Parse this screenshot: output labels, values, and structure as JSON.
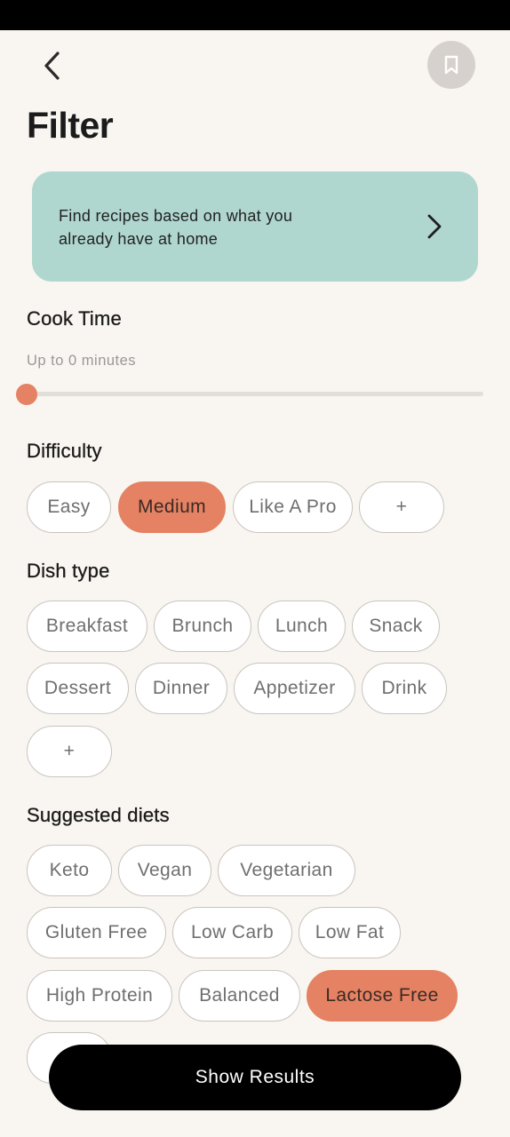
{
  "header": {
    "title": "Filter",
    "back_icon": "chevron-left-icon",
    "bookmark_icon": "bookmark-icon"
  },
  "pantry_banner": {
    "text": "Find recipes based on what you already have at home",
    "icon": "chevron-right-icon",
    "color": "#afd7cf"
  },
  "cook_time": {
    "title": "Cook Time",
    "caption": "Up to 0 minutes",
    "value_minutes": 0
  },
  "difficulty": {
    "title": "Difficulty",
    "options": [
      {
        "label": "Easy",
        "selected": false
      },
      {
        "label": "Medium",
        "selected": true
      },
      {
        "label": "Like A Pro",
        "selected": false
      },
      {
        "label": "+",
        "selected": false
      }
    ]
  },
  "dish_type": {
    "title": "Dish type",
    "options": [
      {
        "label": "Breakfast",
        "selected": false
      },
      {
        "label": "Brunch",
        "selected": false
      },
      {
        "label": "Lunch",
        "selected": false
      },
      {
        "label": "Snack",
        "selected": false
      },
      {
        "label": "Dessert",
        "selected": false
      },
      {
        "label": "Dinner",
        "selected": false
      },
      {
        "label": "Appetizer",
        "selected": false
      },
      {
        "label": "Drink",
        "selected": false
      },
      {
        "label": "+",
        "selected": false
      }
    ]
  },
  "diets": {
    "title": "Suggested diets",
    "options": [
      {
        "label": "Keto",
        "selected": false
      },
      {
        "label": "Vegan",
        "selected": false
      },
      {
        "label": "Vegetarian",
        "selected": false
      },
      {
        "label": "Gluten Free",
        "selected": false
      },
      {
        "label": "Low Carb",
        "selected": false
      },
      {
        "label": "Low Fat",
        "selected": false
      },
      {
        "label": "High Protein",
        "selected": false
      },
      {
        "label": "Balanced",
        "selected": false
      },
      {
        "label": "Lactose Free",
        "selected": true
      }
    ]
  },
  "show_results_label": "Show Results",
  "colors": {
    "accent": "#e48263",
    "background": "#f9f5f0",
    "button": "#000000"
  }
}
